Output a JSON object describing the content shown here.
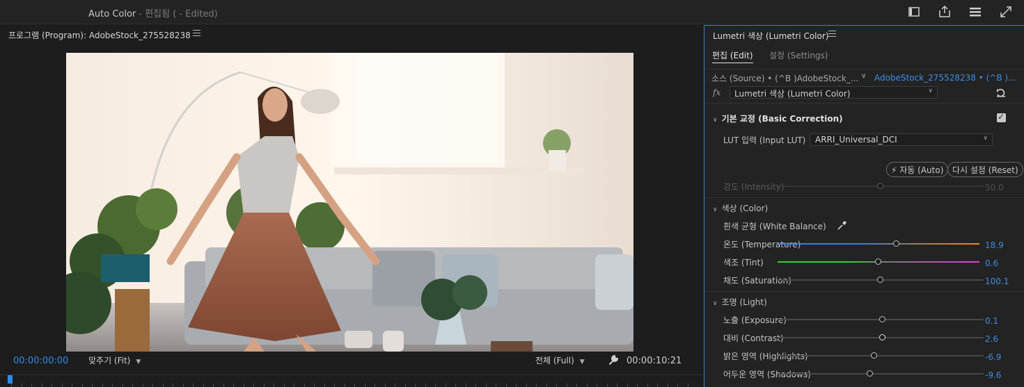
{
  "window": {
    "title": "Auto Color",
    "subtitle": " - 편집됨 ( - Edited)",
    "icons": [
      "panel-icon",
      "export-icon",
      "workspace-menu-icon",
      "fullscreen-icon"
    ]
  },
  "program_monitor": {
    "tab_label": "프로그램 (Program): AdobeStock_275528238",
    "current_time": "00:00:00:00",
    "zoom": "맞추기 (Fit)",
    "resolution": "전체 (Full)",
    "duration": "00:00:10:21"
  },
  "lumetri": {
    "panel_title": "Lumetri 색상 (Lumetri Color)",
    "tabs": [
      {
        "label": "편집 (Edit)",
        "active": true
      },
      {
        "label": "설정 (Settings)",
        "active": false
      }
    ],
    "source_label": "소스 (Source) • (^B )AdobeStock_...",
    "clip_label": "AdobeStock_275528238 • (^B )...",
    "fx_symbol": "fx",
    "effect_name": "Lumetri 색상 (Lumetri Color)",
    "basic": {
      "title": "기본 교정 (Basic Correction)",
      "enabled": true,
      "lut_label": "LUT 입력 (Input LUT)",
      "lut_value": "ARRI_Universal_DCI",
      "auto_label": "자동 (Auto)",
      "reset_label": "다시 설정 (Reset)",
      "intensity": {
        "label": "강도 (Intensity)",
        "value": "50.0",
        "level": 0.5
      },
      "color": {
        "title": "색상 (Color)",
        "white_balance_label": "흰색 균형 (White Balance)",
        "temperature": {
          "label": "온도 (Temperature)",
          "value": "18.9",
          "level": 0.59
        },
        "tint": {
          "label": "색조 (Tint)",
          "value": "0.6",
          "level": 0.5
        },
        "saturation": {
          "label": "채도 (Saturation)",
          "value": "100.1",
          "level": 0.5
        }
      },
      "light": {
        "title": "조명 (Light)",
        "exposure": {
          "label": "노출 (Exposure)",
          "value": "0.1",
          "level": 0.51
        },
        "contrast": {
          "label": "대비 (Contrast)",
          "value": "2.6",
          "level": 0.51
        },
        "highlights": {
          "label": "밝은 영역 (Highlights)",
          "value": "-6.9",
          "level": 0.47
        },
        "shadows": {
          "label": "어두운 영역 (Shadows)",
          "value": "-9.6",
          "level": 0.45
        }
      }
    }
  },
  "colors": {
    "accent": "#2d8ceb",
    "temperature_cold": "#3b7ddd",
    "temperature_warm": "#f08a1c",
    "tint_green": "#2fd13a",
    "tint_magenta": "#e13ce0"
  }
}
